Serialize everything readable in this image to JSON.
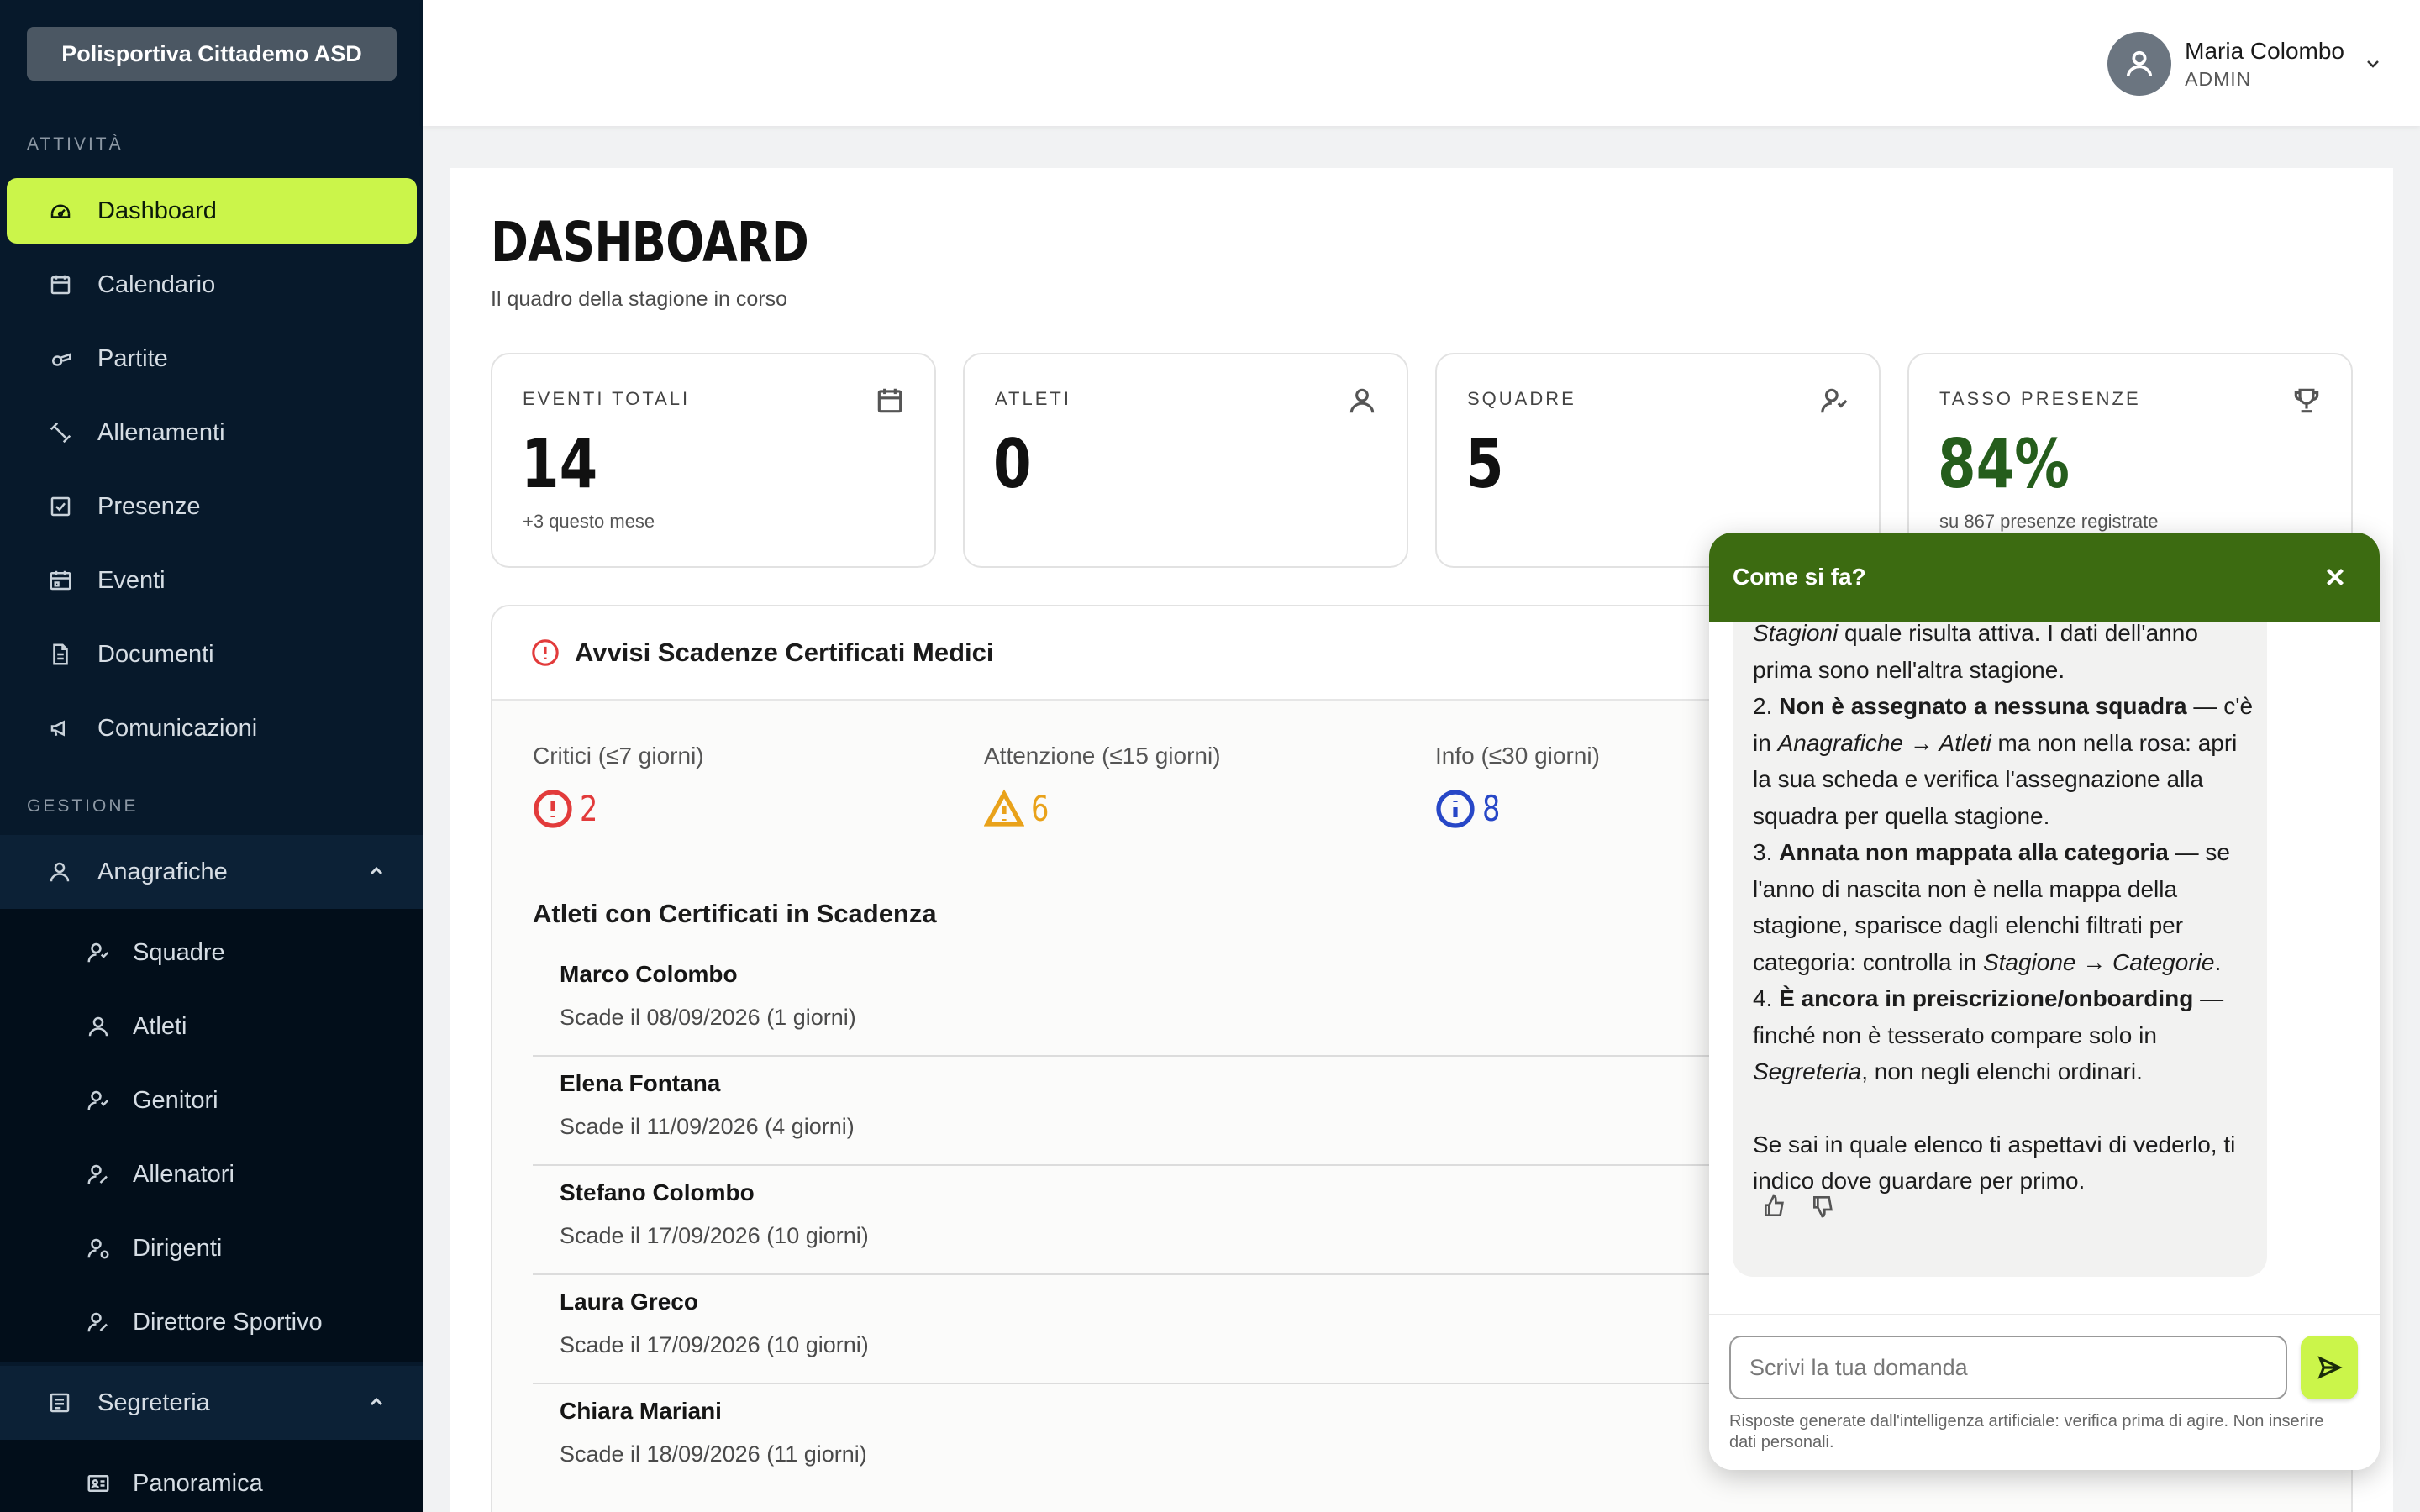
{
  "sidebar": {
    "org_name": "Polisportiva Cittademo ASD",
    "section_activity": "ATTIVITÀ",
    "section_management": "GESTIONE",
    "items": [
      {
        "label": "Dashboard",
        "icon": "gauge-icon",
        "active": true
      },
      {
        "label": "Calendario",
        "icon": "calendar-icon"
      },
      {
        "label": "Partite",
        "icon": "whistle-icon"
      },
      {
        "label": "Allenamenti",
        "icon": "dumbbell-icon"
      },
      {
        "label": "Presenze",
        "icon": "checkbox-icon"
      },
      {
        "label": "Eventi",
        "icon": "calendar-event-icon"
      },
      {
        "label": "Documenti",
        "icon": "document-icon"
      },
      {
        "label": "Comunicazioni",
        "icon": "megaphone-icon"
      }
    ],
    "groups": [
      {
        "label": "Anagrafiche",
        "icon": "user-icon",
        "expanded": true,
        "items": [
          {
            "label": "Squadre",
            "icon": "users-icon"
          },
          {
            "label": "Atleti",
            "icon": "user-icon"
          },
          {
            "label": "Genitori",
            "icon": "users-icon"
          },
          {
            "label": "Allenatori",
            "icon": "user-edit-icon"
          },
          {
            "label": "Dirigenti",
            "icon": "user-cog-icon"
          },
          {
            "label": "Direttore Sportivo",
            "icon": "user-edit-icon"
          }
        ]
      },
      {
        "label": "Segreteria",
        "icon": "register-icon",
        "expanded": true,
        "items": [
          {
            "label": "Panoramica",
            "icon": "id-card-icon"
          }
        ]
      }
    ],
    "accent_color": "#cbf54a",
    "background_color": "#07192b"
  },
  "topbar": {
    "user_name": "Maria Colombo",
    "user_role": "ADMIN"
  },
  "page": {
    "title": "DASHBOARD",
    "subtitle": "Il quadro della stagione in corso"
  },
  "stats": [
    {
      "label": "EVENTI TOTALI",
      "value": "14",
      "sub": "+3 questo mese",
      "icon": "calendar-icon"
    },
    {
      "label": "ATLETI",
      "value": "0",
      "sub": "",
      "icon": "user-icon"
    },
    {
      "label": "SQUADRE",
      "value": "5",
      "sub": "",
      "icon": "users-icon"
    },
    {
      "label": "TASSO PRESENZE",
      "value": "84%",
      "sub": "su 867 presenze registrate",
      "icon": "trophy-icon",
      "value_color": "#255d1c"
    }
  ],
  "alerts": {
    "title": "Avvisi Scadenze Certificati Medici",
    "levels": [
      {
        "label": "Critici (≤7 giorni)",
        "count": "2",
        "color": "#e23b3b",
        "icon": "alert-circle-icon"
      },
      {
        "label": "Attenzione (≤15 giorni)",
        "count": "6",
        "color": "#e9a21a",
        "icon": "warning-triangle-icon"
      },
      {
        "label": "Info (≤30 giorni)",
        "count": "8",
        "color": "#2747c7",
        "icon": "info-circle-icon"
      }
    ],
    "athletes_title": "Atleti con Certificati in Scadenza",
    "athletes": [
      {
        "name": "Marco Colombo",
        "expiry": "Scade il 08/09/2026 (1 giorni)"
      },
      {
        "name": "Elena Fontana",
        "expiry": "Scade il 11/09/2026 (4 giorni)"
      },
      {
        "name": "Stefano Colombo",
        "expiry": "Scade il 17/09/2026 (10 giorni)"
      },
      {
        "name": "Laura Greco",
        "expiry": "Scade il 17/09/2026 (10 giorni)"
      },
      {
        "name": "Chiara Mariani",
        "expiry": "Scade il 18/09/2026 (11 giorni)"
      }
    ]
  },
  "chat": {
    "title": "Come si fa?",
    "header_color": "#3c6b11",
    "message": {
      "l1_em": "Stagioni",
      "l1_rest": " quale risulta attiva. I dati dell'anno prima sono nell'altra stagione.",
      "p2_num": "2. ",
      "p2_bold": "Non è assegnato a nessuna squadra",
      "p2_a": " — c'è in ",
      "p2_em1": "Anagrafiche → Atleti",
      "p2_b": " ma non nella rosa: apri la sua scheda e verifica l'assegnazione alla squadra per quella stagione.",
      "p3_num": "3. ",
      "p3_bold": "Annata non mappata alla categoria",
      "p3_a": " — se l'anno di nascita non è nella mappa della stagione, sparisce dagli elenchi filtrati per categoria: controlla in ",
      "p3_em": "Stagione → Categorie",
      "p3_b": ".",
      "p4_num": "4. ",
      "p4_bold": "È ancora in preiscrizione/onboarding",
      "p4_a": " — finché non è tesserato compare solo in ",
      "p4_em": "Segreteria",
      "p4_b": ", non negli elenchi ordinari.",
      "closing": "Se sai in quale elenco ti aspettavi di vederlo, ti indico dove guardare per primo."
    },
    "input_placeholder": "Scrivi la tua domanda",
    "disclaimer": "Risposte generate dall'intelligenza artificiale: verifica prima di agire. Non inserire dati personali."
  }
}
